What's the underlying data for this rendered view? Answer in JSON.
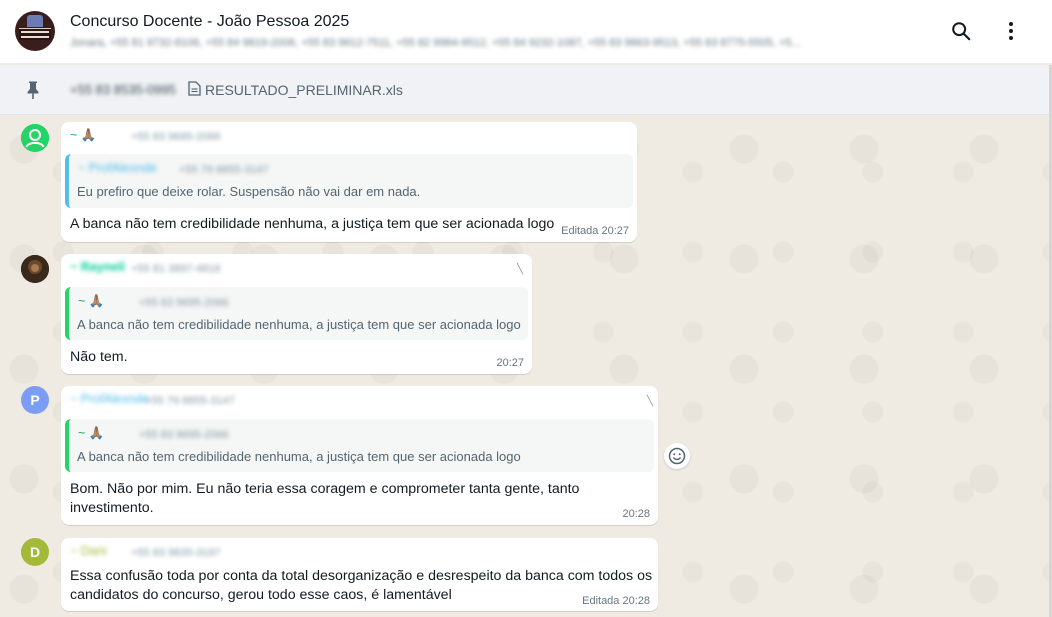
{
  "header": {
    "group_title": "Concurso Docente - João Pessoa 2025",
    "members": "Jonara, +55 81 9732-8106, +55 84 9819-2006, +55 83 9612-7511, +55 82 9984-9512, +55 84 9232-1087, +55 83 9863-9513, +55 83 8775-5505, +5..."
  },
  "pinned": {
    "phone": "+55 83 8535-0995",
    "file_name": "RESULTADO_PRELIMINAR.xls"
  },
  "messages": [
    {
      "sender": "~ 🙏🏽",
      "sender_phone": "+55 83 9695-2066",
      "quote": {
        "sender": "~ ProfAlexnde",
        "phone": "+55 79 8855-3147",
        "text": "Eu prefiro que deixe rolar. Suspensão não vai dar em nada."
      },
      "text": "A banca não tem credibilidade nenhuma, a justiça tem que ser acionada logo",
      "time": "Editada 20:27"
    },
    {
      "sender": "~ Rayneli",
      "sender_phone": "+55 81 3897-4818",
      "quote": {
        "sender": "~ 🙏🏽",
        "phone": "+55 83 9695-2066",
        "text": "A banca não tem credibilidade nenhuma, a justiça tem que ser acionada logo"
      },
      "text": "Não tem.",
      "time": "20:27"
    },
    {
      "sender": "~ ProfAlexnde",
      "sender_phone": "+55 79 8855-3147",
      "avatar_letter": "P",
      "quote": {
        "sender": "~ 🙏🏽",
        "phone": "+55 83 9695-2066",
        "text": "A banca não tem credibilidade nenhuma, a justiça tem que ser acionada logo"
      },
      "text_line1": "Bom. Não por mim. Eu não teria essa coragem e comprometer tanta gente, tanto",
      "text_line2": "investimento.",
      "time": "20:28"
    },
    {
      "sender": "~ Dani",
      "sender_phone": "+55 83 9835-3197",
      "avatar_letter": "D",
      "text_line1": "Essa confusão toda por conta da total desorganização e desrespeito da banca com todos os",
      "text_line2": "candidatos do concurso, gerou todo esse caos, é lamentável",
      "time": "Editada 20:28"
    }
  ],
  "colors": {
    "header_bg": "#ffffff",
    "chat_bg": "#efeae2",
    "quote_bar_blue": "#53bdeb",
    "quote_bar_green": "#25d366",
    "sender_green": "#1fa855",
    "sender_teal": "#06cf9c",
    "sender_blue": "#53bdeb",
    "avatar_green": "#25d366",
    "avatar_p": "#7c9df5",
    "avatar_d": "#a3b938"
  },
  "icons": [
    "search-icon",
    "menu-dots-icon",
    "pin-icon",
    "document-icon",
    "emoji-icon",
    "chevron-down-icon"
  ]
}
